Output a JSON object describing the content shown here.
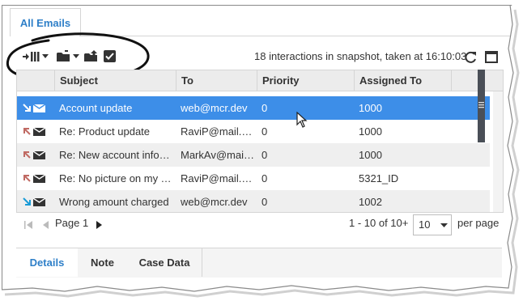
{
  "tab": {
    "label": "All Emails"
  },
  "toolbar": {
    "snapshot_text": "18 interactions in snapshot, taken at 16:10:03",
    "icons": [
      "columns-icon",
      "folder-move-icon",
      "folder-upload-icon",
      "checkbox-icon",
      "refresh-icon",
      "maximize-icon"
    ]
  },
  "table": {
    "columns": [
      "Subject",
      "To",
      "Priority",
      "Assigned To"
    ],
    "rows": [
      {
        "direction": "inbound",
        "subject": "Account update",
        "to": "web@mcr.dev",
        "priority": "0",
        "assigned": "1000",
        "selected": true
      },
      {
        "direction": "outbound",
        "subject": "Re: Product update",
        "to": "RaviP@mail.dev",
        "priority": "0",
        "assigned": "1000"
      },
      {
        "direction": "outbound",
        "subject": "Re: New account inform...",
        "to": "MarkAv@mail....",
        "priority": "0",
        "assigned": "1000"
      },
      {
        "direction": "outbound",
        "subject": "Re: No picture on my TV",
        "to": "RaviP@mail.dev",
        "priority": "0",
        "assigned": "5321_ID"
      },
      {
        "direction": "inbound",
        "subject": "Wrong amount charged",
        "to": "web@mcr.dev",
        "priority": "0",
        "assigned": "1002"
      }
    ]
  },
  "pager": {
    "page_label": "Page 1",
    "range": "1 - 10 of 10+",
    "page_size": "10",
    "per_page_label": "per page"
  },
  "bottom_tabs": [
    "Details",
    "Note",
    "Case Data"
  ],
  "colors": {
    "accent": "#2e7fc8",
    "selected_row": "#3d8ee8",
    "inbound_arrow": "#1a9bd6",
    "outbound_arrow": "#c06a63"
  }
}
